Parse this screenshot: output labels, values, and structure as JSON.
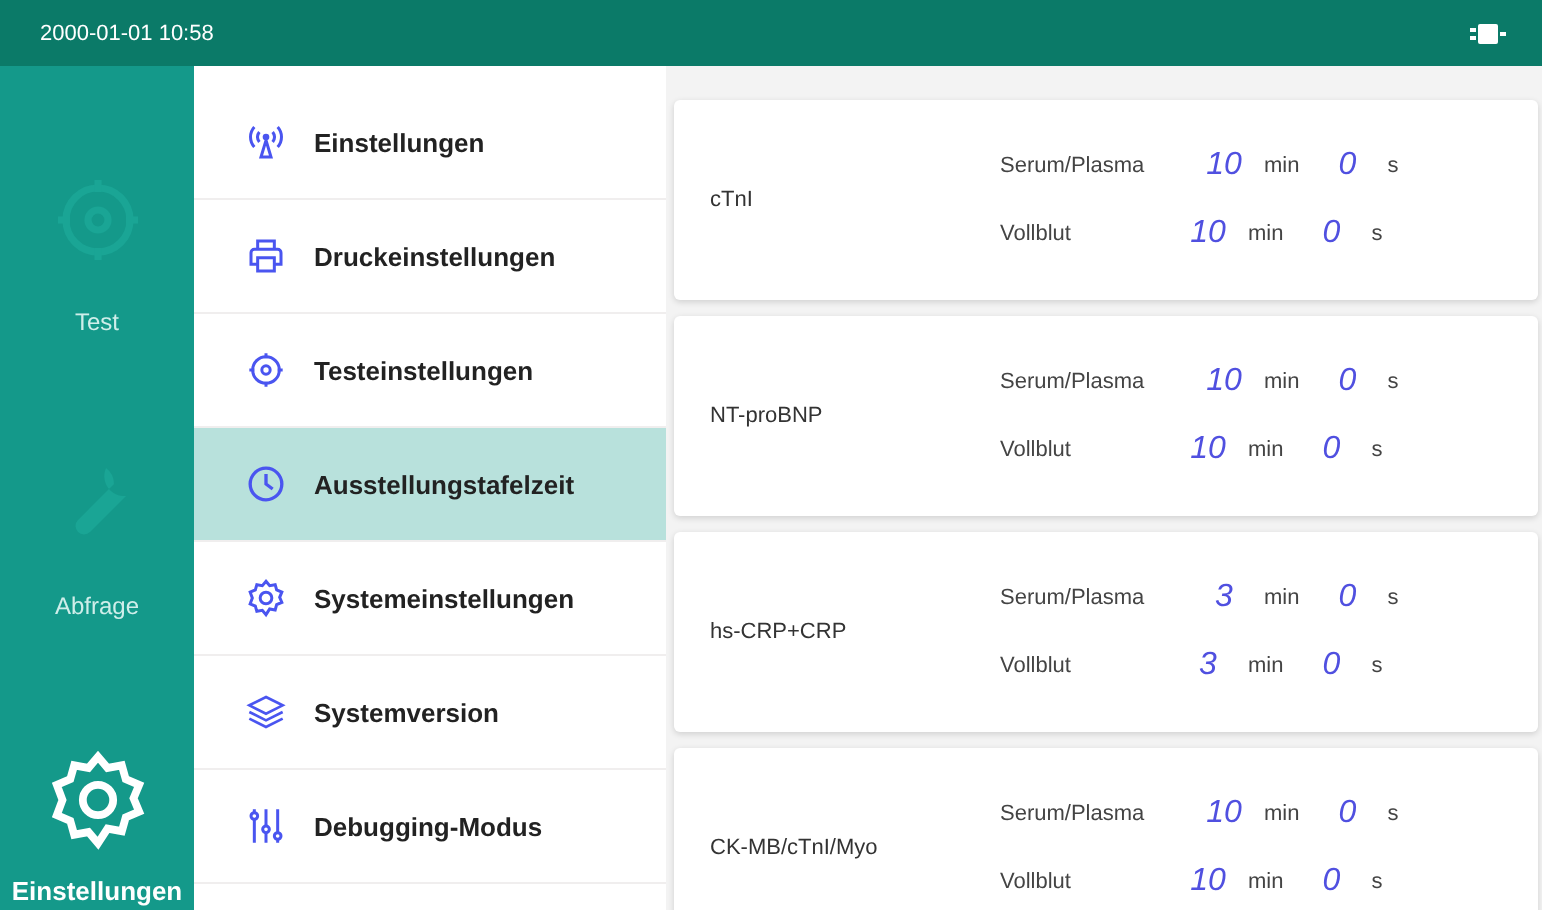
{
  "status_bar": {
    "datetime": "2000-01-01 10:58"
  },
  "nav": [
    {
      "label": "Test",
      "selected": false
    },
    {
      "label": "Abfrage",
      "selected": false
    },
    {
      "label": "Einstellungen",
      "selected": true
    }
  ],
  "menu": [
    {
      "label": "Einstellungen",
      "selected": false
    },
    {
      "label": "Druckeinstellungen",
      "selected": false
    },
    {
      "label": "Testeinstellungen",
      "selected": false
    },
    {
      "label": "Ausstellungstafelzeit",
      "selected": true
    },
    {
      "label": "Systemeinstellungen",
      "selected": false
    },
    {
      "label": "Systemversion",
      "selected": false
    },
    {
      "label": "Debugging-Modus",
      "selected": false
    }
  ],
  "tests": [
    {
      "name": "cTnI",
      "rows": [
        {
          "sample": "Serum/Plasma",
          "minutes": "10",
          "min_unit": "min",
          "seconds": "0",
          "s_unit": "s"
        },
        {
          "sample": "Vollblut",
          "minutes": "10",
          "min_unit": "min",
          "seconds": "0",
          "s_unit": "s"
        }
      ]
    },
    {
      "name": "NT-proBNP",
      "rows": [
        {
          "sample": "Serum/Plasma",
          "minutes": "10",
          "min_unit": "min",
          "seconds": "0",
          "s_unit": "s"
        },
        {
          "sample": "Vollblut",
          "minutes": "10",
          "min_unit": "min",
          "seconds": "0",
          "s_unit": "s"
        }
      ]
    },
    {
      "name": "hs-CRP+CRP",
      "rows": [
        {
          "sample": "Serum/Plasma",
          "minutes": "3",
          "min_unit": "min",
          "seconds": "0",
          "s_unit": "s"
        },
        {
          "sample": "Vollblut",
          "minutes": "3",
          "min_unit": "min",
          "seconds": "0",
          "s_unit": "s"
        }
      ]
    },
    {
      "name": "CK-MB/cTnI/Myo",
      "rows": [
        {
          "sample": "Serum/Plasma",
          "minutes": "10",
          "min_unit": "min",
          "seconds": "0",
          "s_unit": "s"
        },
        {
          "sample": "Vollblut",
          "minutes": "10",
          "min_unit": "min",
          "seconds": "0",
          "s_unit": "s"
        }
      ]
    }
  ]
}
